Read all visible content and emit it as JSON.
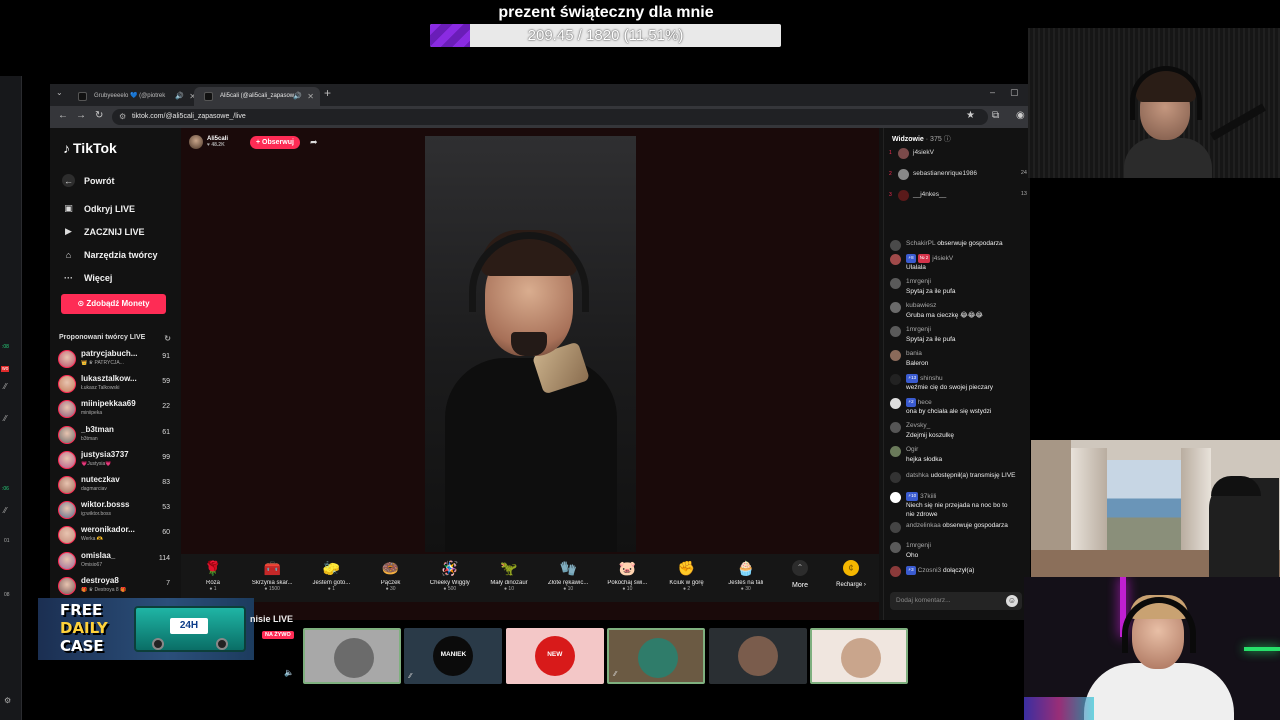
{
  "goal": {
    "title": "prezent świąteczny dla mnie",
    "progress_text": "209.45 / 1820 (11.51%)",
    "progress_fraction": 0.1151,
    "fill_color": "#8a2be2"
  },
  "browser": {
    "tabs": [
      {
        "label": "Grubyeeeelo 💙 (@piotrek",
        "active": false
      },
      {
        "label": "Ali5cali (@ali5cali_zapasow",
        "active": true
      }
    ],
    "url": "tiktok.com/@ali5cali_zapasowe_/live"
  },
  "tiktok": {
    "logo": "TikTok",
    "nav": {
      "back": "Powrót",
      "discover": "Odkryj LIVE",
      "start": "ZACZNIJ LIVE",
      "tools": "Narzędzia twórcy",
      "more": "Więcej"
    },
    "coins_button": "Zdobądź Monety",
    "suggested_header": "Proponowani twórcy LIVE",
    "creators": [
      {
        "name": "patrycjabuch...",
        "sub": "👑 ♛ PATRYCJA...",
        "count": "91"
      },
      {
        "name": "lukasztalkow...",
        "sub": "Łukasz Talkowski",
        "count": "59"
      },
      {
        "name": "miinipekkaa69",
        "sub": "miniipeka",
        "count": "22"
      },
      {
        "name": "_b3tman",
        "sub": "b3tman",
        "count": "61"
      },
      {
        "name": "justysia3737",
        "sub": "💗Justysia💗",
        "count": "99"
      },
      {
        "name": "nuteczkav",
        "sub": "dagmarciav",
        "count": "83"
      },
      {
        "name": "wiktor.bosss",
        "sub": "ig:wiktor.boss",
        "count": "53"
      },
      {
        "name": "weronikador...",
        "sub": "Werka 🫶",
        "count": "60"
      },
      {
        "name": "omislaa_",
        "sub": "Omisio67",
        "count": "114"
      },
      {
        "name": "destroya8",
        "sub": "🎁 ♛ Destroya 8 🎁",
        "count": "7"
      }
    ],
    "host": {
      "name": "Ali5cali",
      "likes": "♥ 48.2K",
      "follow": "+ Obserwuj"
    },
    "gifts": [
      {
        "icon": "🌹",
        "name": "Róża",
        "price": "● 1"
      },
      {
        "icon": "🧰",
        "name": "Skrzynia skar...",
        "price": "● 1500"
      },
      {
        "icon": "🧽",
        "name": "Jestem goto...",
        "price": "● 1"
      },
      {
        "icon": "🍩",
        "name": "Pączek",
        "price": "● 30"
      },
      {
        "icon": "🪅",
        "name": "Cheeky Wiggly",
        "price": "● 500"
      },
      {
        "icon": "🦖",
        "name": "Mały dinozaur",
        "price": "● 10"
      },
      {
        "icon": "🧤",
        "name": "Złote rękawic...",
        "price": "● 10"
      },
      {
        "icon": "🐷",
        "name": "Pokochaj świ...",
        "price": "● 10"
      },
      {
        "icon": "✊",
        "name": "Kciuk w górę",
        "price": "● 2"
      },
      {
        "icon": "🧁",
        "name": "Jesteś na fali",
        "price": "● 30"
      }
    ],
    "more_label": "More",
    "recharge_label": "Recharge ›",
    "viewers": {
      "title": "Widzowie",
      "count": "· 375",
      "top": [
        {
          "rank": "1",
          "name": "j4siekV",
          "score": ""
        },
        {
          "rank": "2",
          "name": "sebastianenrique1986",
          "score": "24"
        },
        {
          "rank": "3",
          "name": "__j4nkes__",
          "score": "13"
        }
      ]
    },
    "chat": [
      {
        "user": "SchakirPL",
        "text": "obserwuje gospodarza",
        "inline": true,
        "badge": ""
      },
      {
        "user": "j4siekV",
        "text": "Ulalala",
        "inline": false,
        "badge": "⚡8",
        "badge2": "№ 2"
      },
      {
        "user": "1mrgenji",
        "text": "Spytaj za ile pufa",
        "inline": false,
        "badge": ""
      },
      {
        "user": "kubawiesz",
        "text": "Gruba ma cieczkę 😂😂😂",
        "inline": false,
        "badge": ""
      },
      {
        "user": "1mrgenji",
        "text": "Spytaj za ile pufa",
        "inline": false,
        "badge": ""
      },
      {
        "user": "bania",
        "text": "Baleron",
        "inline": false,
        "badge": ""
      },
      {
        "user": "shinshu",
        "text": "weźmie cię do swojej pieczary",
        "inline": false,
        "badge": "⚡13"
      },
      {
        "user": "hece",
        "text": "ona by chciała ale się wstydzi",
        "inline": false,
        "badge": "⚡2"
      },
      {
        "user": "Zevsky_",
        "text": "Zdejmij koszulkę",
        "inline": false,
        "badge": ""
      },
      {
        "user": "Ogir",
        "text": "hejka słodka",
        "inline": false,
        "badge": ""
      },
      {
        "user": "datshka",
        "text": "udostępnił(a) transmisję LIVE",
        "inline": true,
        "badge": ""
      },
      {
        "user": "37kiili",
        "text": "Niech się nie przejada na noc bo to",
        "text2": "nie zdrowe",
        "inline": false,
        "badge": "⚡10"
      },
      {
        "user": "andzelinkaa",
        "text": "obserwuje gospodarza",
        "inline": true,
        "badge": ""
      },
      {
        "user": "1mrgenji",
        "text": "Oho",
        "inline": false,
        "badge": ""
      },
      {
        "user": "Czosni3",
        "text": "dołączył(a)",
        "inline": true,
        "badge": "⚡3"
      }
    ],
    "chat_placeholder": "Dodaj komentarz..."
  },
  "ad": {
    "line1": "FREE",
    "line2": "DAILY",
    "line3": "CASE",
    "box_label": "24H"
  },
  "bottom": {
    "label": "nisie LIVE",
    "live_badge": "NA ŻYWO",
    "tiles": [
      {
        "text": "",
        "bg": "#a8a8a8",
        "circle": "#6b6b6b",
        "border": "#7fb07f"
      },
      {
        "text": "MANIEK",
        "bg": "#2a3a48",
        "circle": "#0b0b0b",
        "border": ""
      },
      {
        "text": "NEW",
        "bg": "#f3c7c7",
        "circle": "#d81a1a",
        "border": ""
      },
      {
        "text": "",
        "bg": "#6b5a43",
        "circle": "#2f7c6a",
        "border": "#7fb07f"
      },
      {
        "text": "",
        "bg": "#2a2f33",
        "circle": "#7a5c4c",
        "border": ""
      },
      {
        "text": "",
        "bg": "#f0e6df",
        "circle": "#c9a58c",
        "border": "#7fb07f"
      }
    ]
  }
}
